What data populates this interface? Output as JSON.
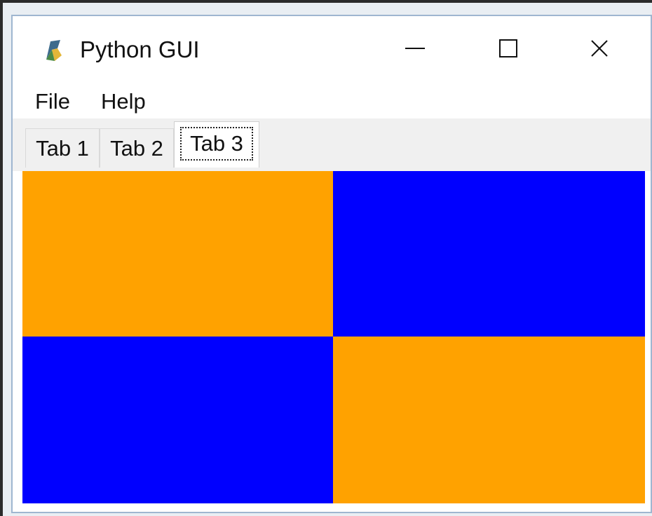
{
  "window": {
    "title": "Python GUI",
    "icon": "python-feather-icon"
  },
  "window_controls": {
    "minimize_icon": "minimize-icon",
    "maximize_icon": "maximize-icon",
    "close_icon": "close-icon",
    "close_glyph": "✕"
  },
  "menu": {
    "items": [
      {
        "label": "File"
      },
      {
        "label": "Help"
      }
    ]
  },
  "tabs": [
    {
      "label": "Tab 1",
      "selected": false
    },
    {
      "label": "Tab 2",
      "selected": false
    },
    {
      "label": "Tab 3",
      "selected": true
    }
  ],
  "canvas": {
    "grid": [
      [
        "#ffa200",
        "#0000ff"
      ],
      [
        "#0000ff",
        "#ffa200"
      ]
    ]
  }
}
